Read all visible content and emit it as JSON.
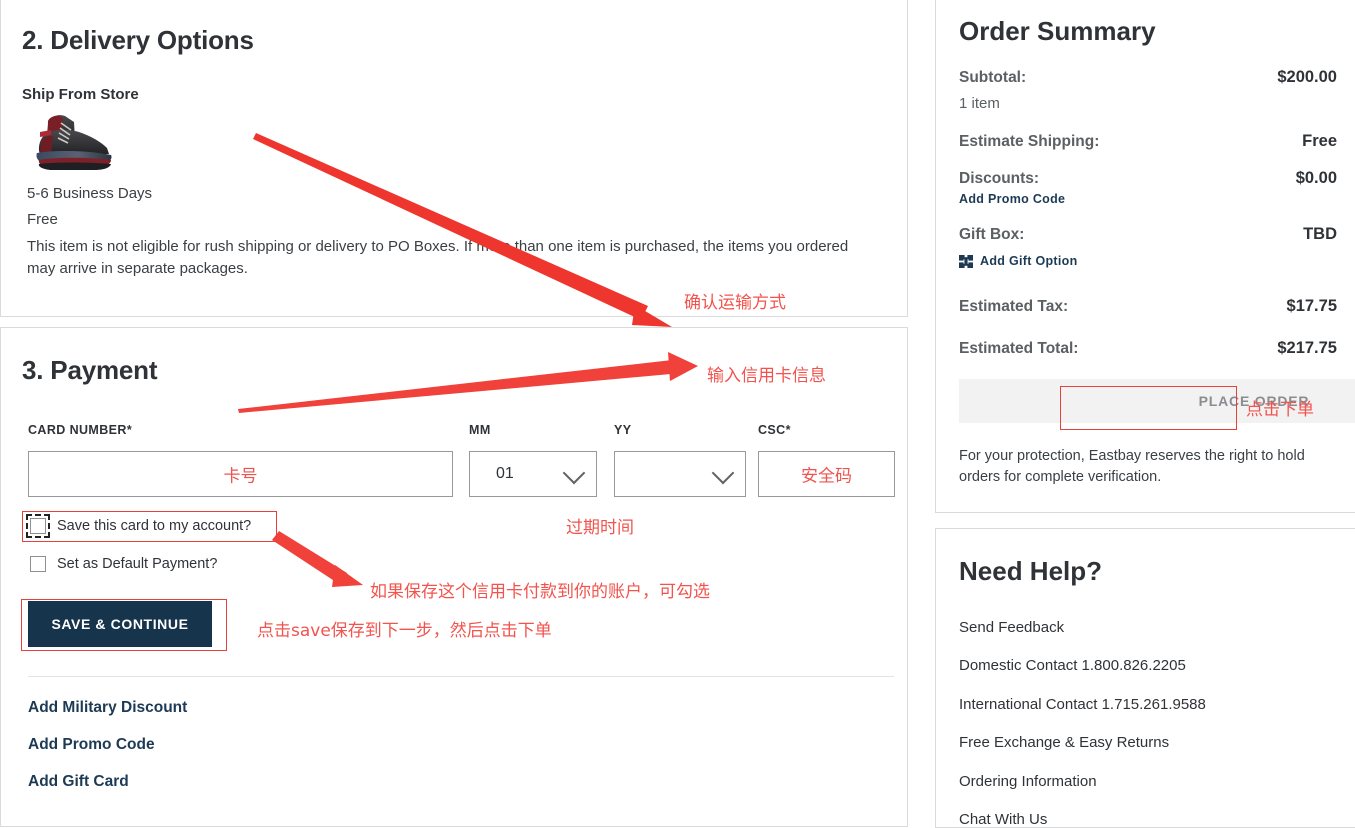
{
  "delivery": {
    "heading": "2. Delivery Options",
    "ship_from_store": "Ship From Store",
    "product_image_alt": "black-red-basketball-sneaker",
    "eta": "5-6 Business Days",
    "price": "Free",
    "note": "This item is not eligible for rush shipping or delivery to PO Boxes. If more than one item is purchased, the items you ordered may arrive in separate packages."
  },
  "payment": {
    "heading": "3. Payment",
    "card_number_label": "CARD NUMBER*",
    "card_number_value": "",
    "mm_label": "MM",
    "mm_value": "01",
    "yy_label": "YY",
    "yy_value": "",
    "csc_label": "CSC*",
    "csc_value": "",
    "save_card_label": "Save this card to my account?",
    "set_default_label": "Set as Default Payment?",
    "save_button": "SAVE & CONTINUE",
    "links": [
      "Add Military Discount",
      "Add Promo Code",
      "Add Gift Card"
    ]
  },
  "summary": {
    "title": "Order Summary",
    "rows": [
      {
        "key": "Subtotal:",
        "value": "$200.00",
        "sub": "1 item"
      },
      {
        "key": "Estimate Shipping:",
        "value": "Free"
      },
      {
        "key": "Discounts:",
        "value": "$0.00",
        "link": "Add Promo Code"
      },
      {
        "key": "Gift Box:",
        "value": "TBD",
        "link": "Add Gift Option",
        "link_icon": "gift-option-icon"
      },
      {
        "key": "Estimated Tax:",
        "value": "$17.75"
      },
      {
        "key": "Estimated Total:",
        "value": "$217.75"
      }
    ],
    "place_order_label": "PLACE ORDER",
    "protection_note": "For your protection, Eastbay reserves the right to hold orders for complete verification."
  },
  "help": {
    "title": "Need Help?",
    "links": [
      "Send Feedback",
      "Domestic Contact 1.800.826.2205",
      "International Contact 1.715.261.9588",
      "Free Exchange & Easy Returns",
      "Ordering Information",
      "Chat With Us"
    ]
  },
  "annotations": {
    "shipping_method": "确认运输方式",
    "enter_card_info": "输入信用卡信息",
    "card_number_ph": "卡号",
    "expiry_ph": "过期时间",
    "csc_ph": "安全码",
    "save_card_note": "如果保存这个信用卡付款到你的账户，可勾选",
    "save_continue_note": "点击save保存到下一步，然后点击下单",
    "place_order_note": "点击下单"
  },
  "colors": {
    "annotation_red": "#f2534d",
    "button_navy": "#16344c",
    "link_navy": "#1d3a55",
    "panel_border": "#d8dadc",
    "order_bar": "#f2f2f2"
  }
}
